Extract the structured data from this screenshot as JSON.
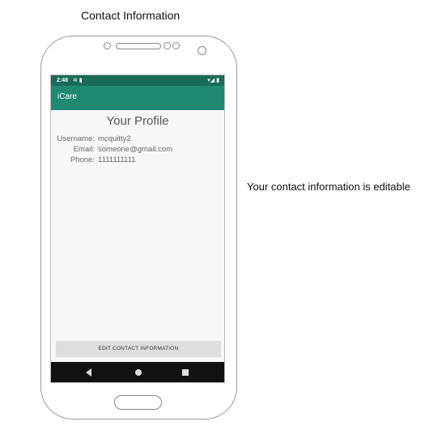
{
  "captions": {
    "title": "Contact Information",
    "side_note": "Your contact information is editable"
  },
  "status_bar": {
    "time": "2:48",
    "left_icons": "✲ ▮",
    "right_icons": "▾◢ ▮"
  },
  "app_bar": {
    "title": "iCare"
  },
  "profile": {
    "heading": "Your Profile",
    "fields": [
      {
        "label": "Username:",
        "value": "mcquitty2"
      },
      {
        "label": "Email:",
        "value": "someone@gmail.com"
      },
      {
        "label": "Phone:",
        "value": "1111111111"
      }
    ]
  },
  "actions": {
    "edit_label": "EDIT CONTACT INFORMATION"
  },
  "nav_icons": [
    "back-icon",
    "home-icon",
    "recent-apps-icon"
  ]
}
